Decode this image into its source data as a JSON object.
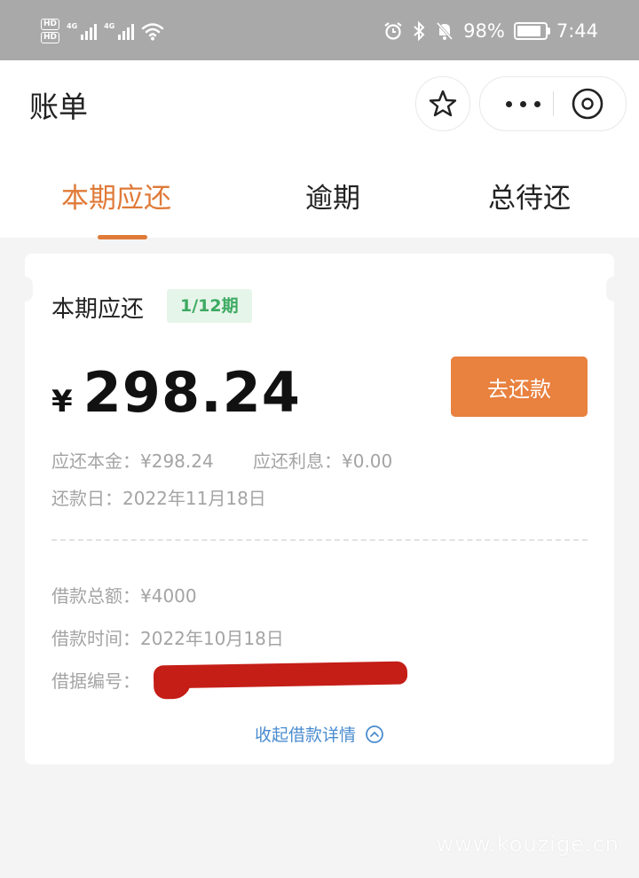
{
  "status_bar": {
    "network_left": "HD",
    "signal_label": "4G",
    "battery": "98%",
    "time": "7:44"
  },
  "header": {
    "title": "账单"
  },
  "tabs": [
    {
      "label": "本期应还",
      "active": true
    },
    {
      "label": "逾期",
      "active": false
    },
    {
      "label": "总待还",
      "active": false
    }
  ],
  "bill": {
    "title": "本期应还",
    "period_badge": "1/12期",
    "currency": "¥",
    "amount": "298.24",
    "pay_button": "去还款",
    "principal": "应还本金：¥298.24",
    "interest": "应还利息：¥0.00",
    "due_date": "还款日：2022年11月18日",
    "loan_total": "借款总额：¥4000",
    "loan_time": "借款时间：2022年10月18日",
    "loan_no_label": "借据编号：",
    "collapse_label": "收起借款详情"
  },
  "watermark": "www.kouzige.cn",
  "colors": {
    "accent": "#e07a38",
    "button": "#e9813f",
    "badge_bg": "#e6f5ea",
    "badge_text": "#3daa62",
    "link": "#4a8cd0"
  }
}
